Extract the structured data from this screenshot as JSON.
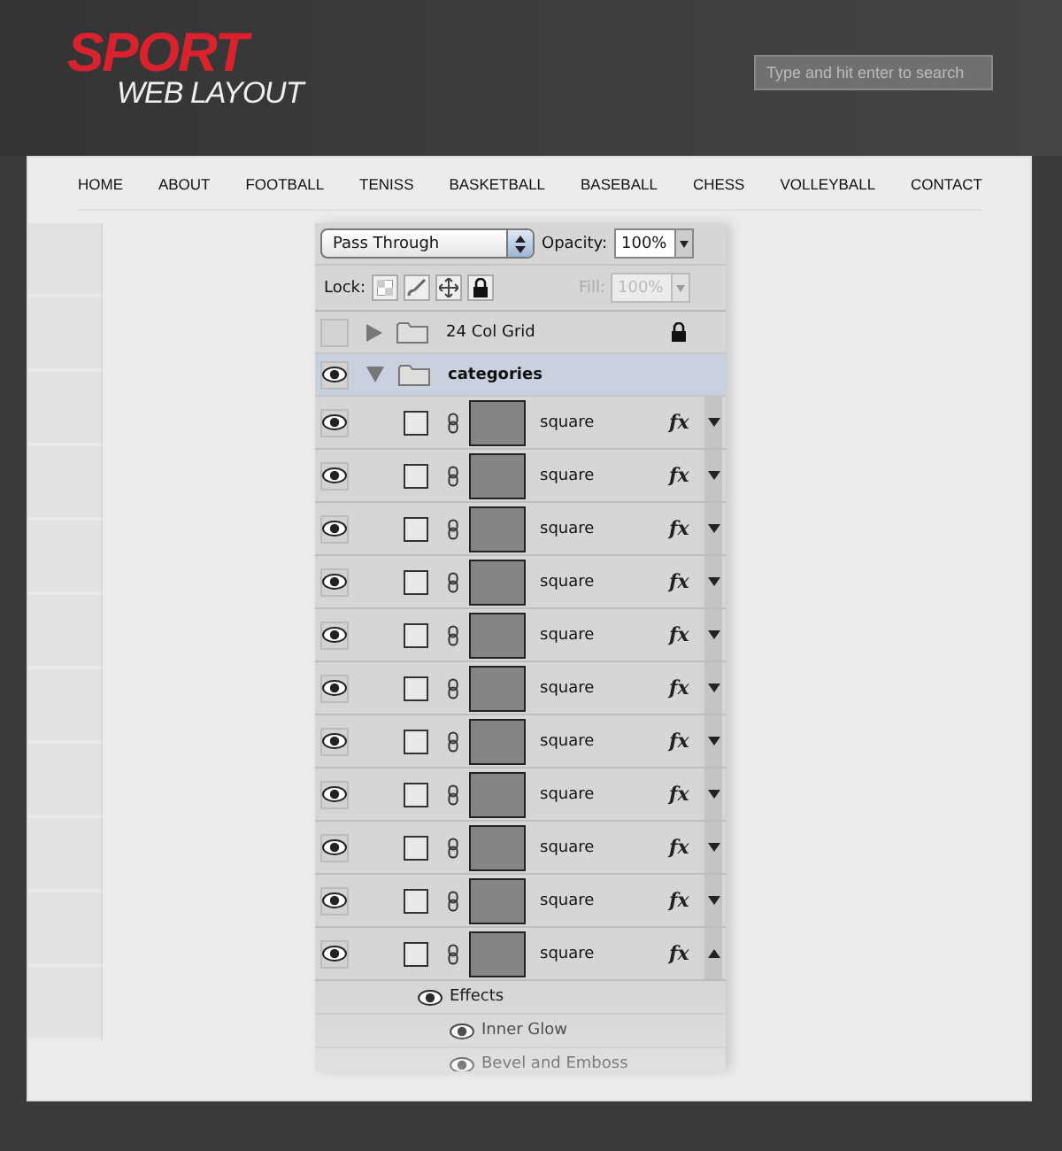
{
  "header": {
    "logo_title": "SPORT",
    "logo_subtitle": "WEB LAYOUT",
    "search": {
      "placeholder": "Type and hit enter to search"
    }
  },
  "nav": [
    "HOME",
    "ABOUT",
    "FOOTBALL",
    "TENISS",
    "BASKETBALL",
    "BASEBALL",
    "CHESS",
    "VOLLEYBALL",
    "CONTACT"
  ],
  "layers_panel": {
    "blend_mode": "Pass Through",
    "opacity_label": "Opacity:",
    "opacity": "100%",
    "lock_label": "Lock:",
    "fill_label": "Fill:",
    "fill": "100%",
    "fill_disabled": true,
    "groups": [
      {
        "name": "24 Col Grid",
        "visible": false,
        "expanded": false,
        "locked": true,
        "selected": false
      },
      {
        "name": "categories",
        "visible": true,
        "expanded": true,
        "locked": false,
        "selected": true,
        "children": [
          {
            "name": "square",
            "visible": true,
            "expanded": false,
            "badge": "fx"
          },
          {
            "name": "square",
            "visible": true,
            "expanded": false,
            "badge": "fx"
          },
          {
            "name": "square",
            "visible": true,
            "expanded": false,
            "badge": "fx"
          },
          {
            "name": "square",
            "visible": true,
            "expanded": false,
            "badge": "fx"
          },
          {
            "name": "square",
            "visible": true,
            "expanded": false,
            "badge": "fx"
          },
          {
            "name": "square",
            "visible": true,
            "expanded": false,
            "badge": "fx"
          },
          {
            "name": "square",
            "visible": true,
            "expanded": false,
            "badge": "fx"
          },
          {
            "name": "square",
            "visible": true,
            "expanded": false,
            "badge": "fx"
          },
          {
            "name": "square",
            "visible": true,
            "expanded": false,
            "badge": "fx"
          },
          {
            "name": "square",
            "visible": true,
            "expanded": false,
            "badge": "fx"
          },
          {
            "name": "square",
            "visible": true,
            "expanded": true,
            "badge": "fx",
            "effects": {
              "label": "Effects",
              "visible": true,
              "items": [
                {
                  "name": "Inner Glow",
                  "visible": true
                },
                {
                  "name": "Bevel and Emboss",
                  "visible": true
                }
              ]
            }
          }
        ]
      }
    ]
  }
}
